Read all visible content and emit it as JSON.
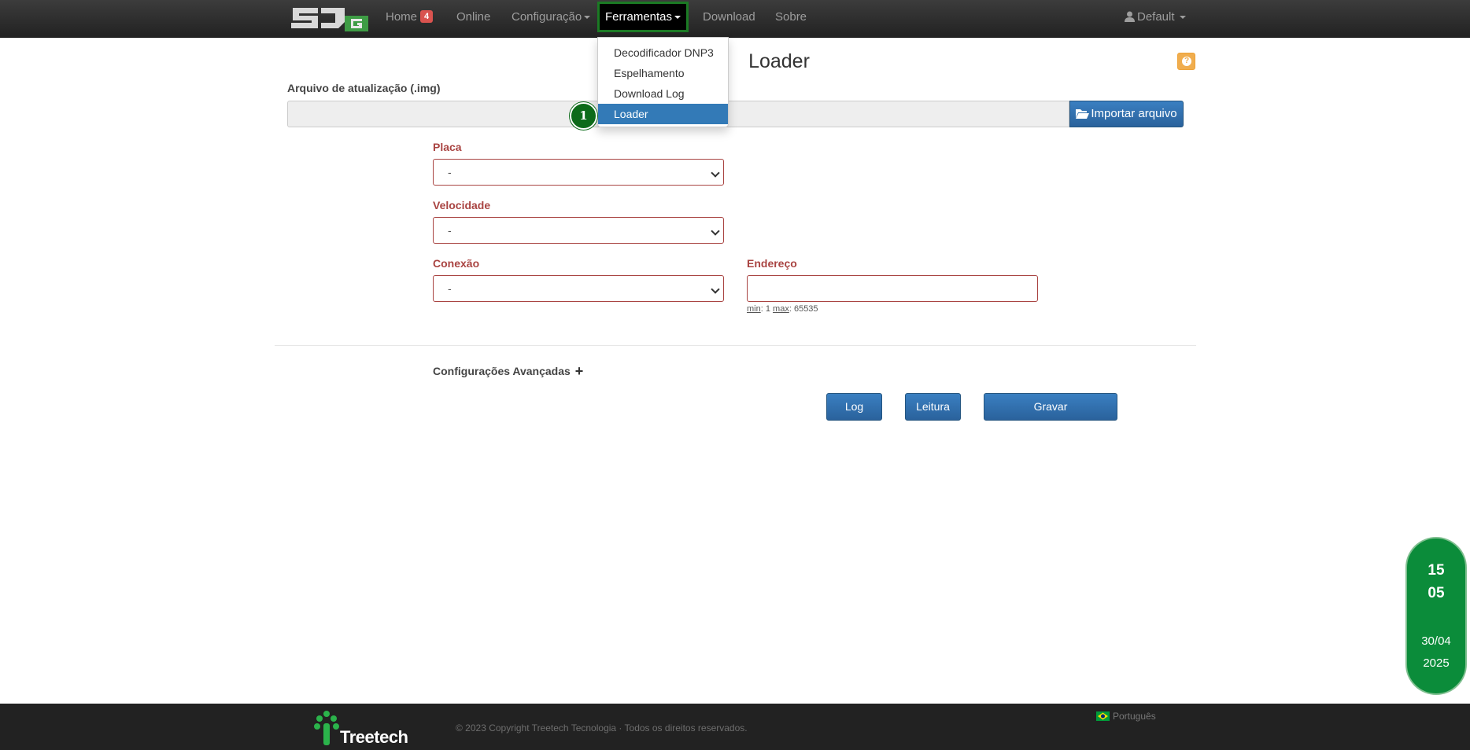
{
  "navbar": {
    "home_label": "Home",
    "home_badge": "4",
    "online_label": "Online",
    "config_label": "Configuração",
    "tools_label": "Ferramentas",
    "download_label": "Download",
    "about_label": "Sobre",
    "user_label": "Default"
  },
  "tools_menu": {
    "items": [
      "Decodificador DNP3",
      "Espelhamento",
      "Download Log",
      "Loader"
    ],
    "active": "Loader"
  },
  "marker": "1",
  "page": {
    "title": "Loader",
    "file_label": "Arquivo de atualização (.img)",
    "import_button": "Importar arquivo",
    "placa": {
      "label": "Placa",
      "value": "-"
    },
    "velocidade": {
      "label": "Velocidade",
      "value": "-"
    },
    "conexao": {
      "label": "Conexão",
      "value": "-"
    },
    "endereco": {
      "label": "Endereço",
      "value": "",
      "hint_min_label": "min",
      "hint_min": "1",
      "hint_max_label": "max",
      "hint_max": "65535"
    },
    "advanced_label": "Configurações Avançadas",
    "buttons": {
      "log": "Log",
      "leitura": "Leitura",
      "gravar": "Gravar"
    }
  },
  "clock": {
    "hour": "15",
    "minute": "05",
    "date": "30/04",
    "year": "2025"
  },
  "footer": {
    "brand": "Treetech",
    "copyright": "© 2023 Copyright Treetech Tecnologia · Todos os direitos reservados.",
    "language": "Português"
  },
  "colors": {
    "accent": "#337ab7",
    "error": "#a94442",
    "highlight": "#1b7a24",
    "clock_bg": "#0b8c3a",
    "help": "#f0ad4e"
  }
}
